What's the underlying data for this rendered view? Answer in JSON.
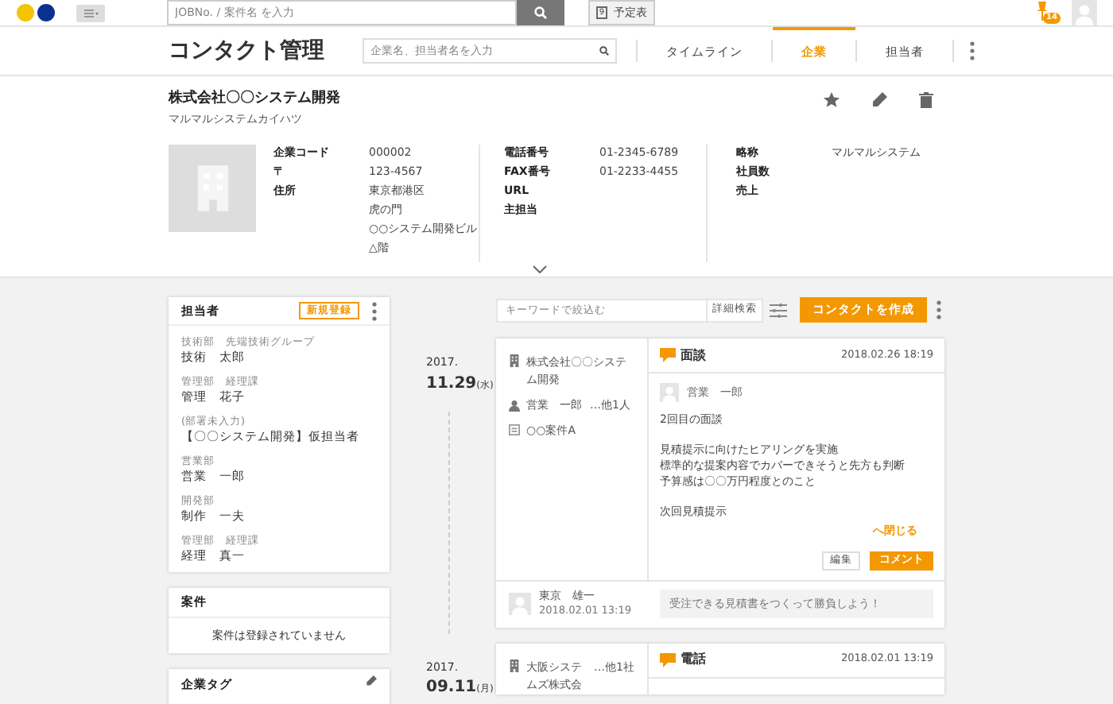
{
  "topbar": {
    "search_placeholder": "JOBNo. / 案件名 を入力",
    "schedule_icon_text": "9",
    "schedule_button": "予定表",
    "notification_count": "14"
  },
  "nav": {
    "title": "コンタクト管理",
    "search_placeholder": "企業名、担当者名を入力",
    "tabs": [
      {
        "label": "タイムライン",
        "selected": false
      },
      {
        "label": "企業",
        "selected": true
      },
      {
        "label": "担当者",
        "selected": false
      }
    ]
  },
  "company": {
    "name": "株式会社〇〇システム開発",
    "kana": "マルマルシステムカイハツ",
    "columns": [
      [
        {
          "label": "企業コード",
          "value": [
            "000002"
          ]
        },
        {
          "label": "〒",
          "value": [
            "123-4567"
          ]
        },
        {
          "label": "住所",
          "value": [
            "東京都港区",
            "虎の門",
            "○○システム開発ビル",
            "△階"
          ]
        }
      ],
      [
        {
          "label": "電話番号",
          "value": [
            "01-2345-6789"
          ]
        },
        {
          "label": "FAX番号",
          "value": [
            "01-2233-4455"
          ]
        },
        {
          "label": "URL"
        },
        {
          "label": "主担当"
        }
      ],
      [
        {
          "label": "略称",
          "value": [
            "マルマルシステム"
          ]
        },
        {
          "label": "社員数"
        },
        {
          "label": "売上"
        }
      ]
    ]
  },
  "contacts": {
    "title": "担当者",
    "new_button": "新規登録",
    "people": [
      {
        "dept": "技術部　先端技術グループ",
        "name": "技術　太郎"
      },
      {
        "dept": "管理部　経理課",
        "name": "管理　花子"
      },
      {
        "dept": "(部署未入力)",
        "name": "【〇〇システム開発】仮担当者"
      },
      {
        "dept": "営業部",
        "name": "営業　一郎"
      },
      {
        "dept": "開発部",
        "name": "制作　一夫"
      },
      {
        "dept": "管理部　経理課",
        "name": "経理　真一"
      }
    ]
  },
  "projects": {
    "title": "案件",
    "empty": "案件は登録されていません"
  },
  "tags": {
    "title": "企業タグ"
  },
  "timeline": {
    "search_placeholder": "キーワードで絞込む",
    "advanced_search": "詳細検索",
    "create_button": "コンタクトを作成",
    "entries": [
      {
        "year": "2017.",
        "date": "11.29",
        "weekday": "(水)",
        "company": "株式会社〇〇システム開発",
        "person": "営業　一郎",
        "person_others": "…他1人",
        "project": "○○案件A",
        "type": "面談",
        "timestamp": "2018.02.26 18:19",
        "author": "営業　一郎",
        "body": [
          [
            "2回目の面談"
          ],
          [
            "見積提示に向けたヒアリングを実施",
            "標準的な提案内容でカバーできそうと先方も判断",
            "予算感は〇〇万円程度とのこと"
          ],
          [
            "次回見積提示"
          ]
        ],
        "collapse": "へ閉じる",
        "edit": "編集",
        "comment": "コメント",
        "commenter": "東京　雄一",
        "comment_time": "2018.02.01 13:19",
        "comment_placeholder": "受注できる見積書をつくって勝負しよう！"
      },
      {
        "year": "2017.",
        "date": "09.11",
        "weekday": "(月)",
        "company": "大阪システムズ株式会",
        "company_others": "…他1社",
        "type": "電話",
        "timestamp": "2018.02.01 13:19"
      }
    ]
  }
}
